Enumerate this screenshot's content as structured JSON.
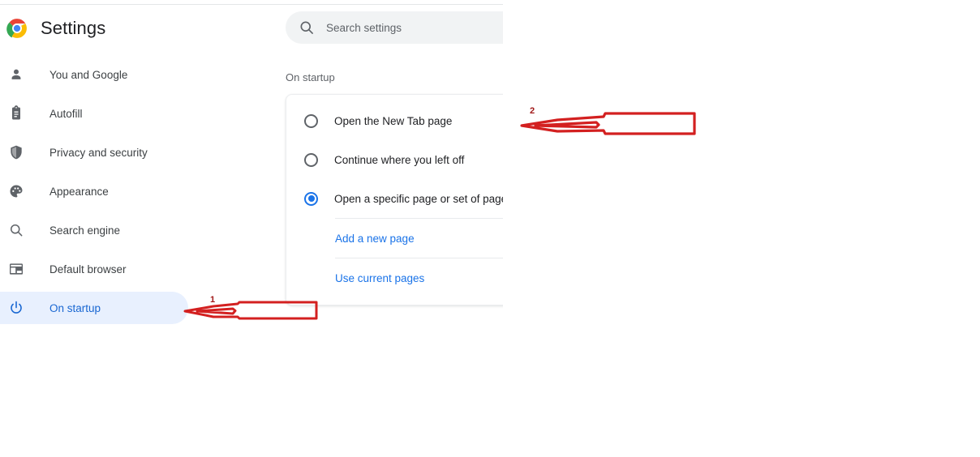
{
  "window": {
    "app": "Google Chrome Settings"
  },
  "header": {
    "logo_icon": "chrome-logo-icon",
    "title": "Settings"
  },
  "search": {
    "icon": "search-icon",
    "value": "",
    "placeholder": "Search settings"
  },
  "sidebar": {
    "items": [
      {
        "label": "You and Google",
        "icon": "person-icon",
        "selected": false
      },
      {
        "label": "Autofill",
        "icon": "clipboard-icon",
        "selected": false
      },
      {
        "label": "Privacy and security",
        "icon": "shield-icon",
        "selected": false
      },
      {
        "label": "Appearance",
        "icon": "palette-icon",
        "selected": false
      },
      {
        "label": "Search engine",
        "icon": "magnifier-icon",
        "selected": false
      },
      {
        "label": "Default browser",
        "icon": "browser-window-icon",
        "selected": false
      },
      {
        "label": "On startup",
        "icon": "power-icon",
        "selected": true
      }
    ]
  },
  "main": {
    "section_title": "On startup",
    "startup_options": [
      {
        "label": "Open the New Tab page",
        "checked": false
      },
      {
        "label": "Continue where you left off",
        "checked": false
      },
      {
        "label": "Open a specific page or set of pages",
        "checked": true
      }
    ],
    "links": [
      {
        "label": "Add a new page"
      },
      {
        "label": "Use current pages"
      }
    ]
  },
  "annotations": [
    {
      "number": "1",
      "points_to": "sidebar-item-on-startup"
    },
    {
      "number": "2",
      "points_to": "startup-option-open-new-tab-page"
    }
  ],
  "colors": {
    "accent_blue": "#1a73e8",
    "selected_nav_bg": "#e8f0fe",
    "selected_nav_text": "#1967d2",
    "annotation_red": "#d32020",
    "annotation_label_red": "#a01818",
    "text_primary": "#202124",
    "text_secondary": "#5f6368",
    "search_bg": "#f1f3f4"
  }
}
